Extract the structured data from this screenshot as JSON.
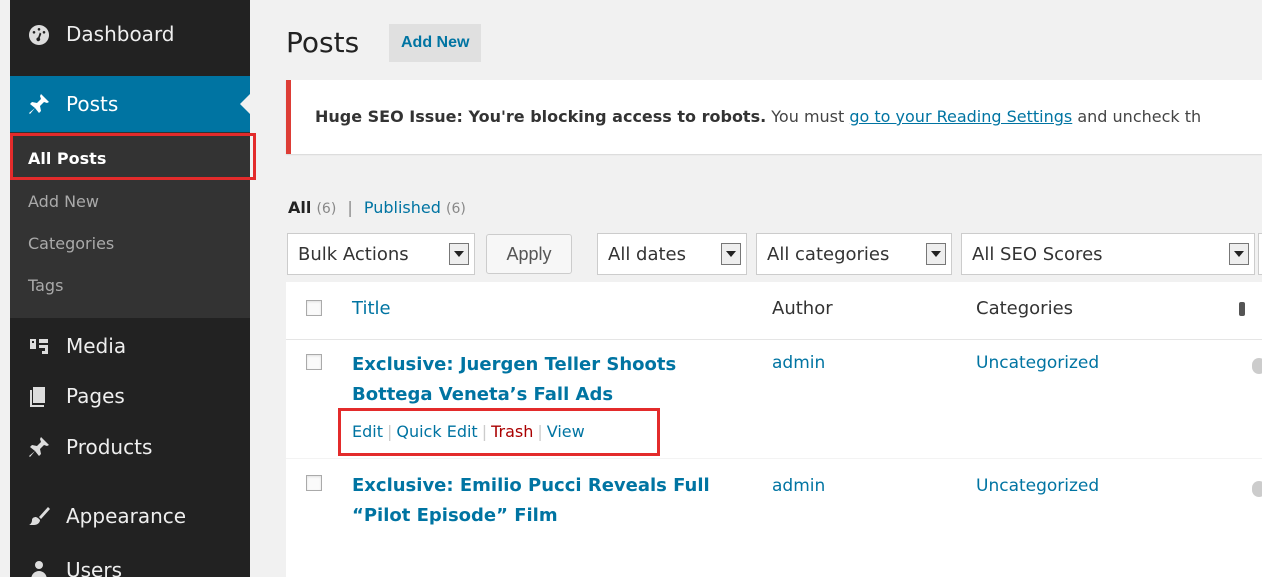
{
  "sidebar": {
    "items": [
      {
        "label": "Dashboard",
        "icon": "dashboard-icon"
      },
      {
        "label": "Posts",
        "icon": "pin-icon"
      },
      {
        "label": "Media",
        "icon": "media-icon"
      },
      {
        "label": "Pages",
        "icon": "pages-icon"
      },
      {
        "label": "Products",
        "icon": "pin-icon"
      },
      {
        "label": "Appearance",
        "icon": "paintbrush-icon"
      },
      {
        "label": "Users",
        "icon": "user-icon"
      }
    ],
    "submenu": [
      "All Posts",
      "Add New",
      "Categories",
      "Tags"
    ]
  },
  "header": {
    "title": "Posts",
    "add_new": "Add New"
  },
  "notice": {
    "bold": "Huge SEO Issue: You're blocking access to robots.",
    "text": " You must ",
    "link": "go to your Reading Settings",
    "rest": " and uncheck th"
  },
  "filters": {
    "all_label": "All",
    "all_count": "(6)",
    "sep": "|",
    "published_label": "Published",
    "published_count": "(6)"
  },
  "toolbar": {
    "bulk_actions": "Bulk Actions",
    "apply": "Apply",
    "dates": "All dates",
    "categories": "All categories",
    "seo": "All SEO Scores"
  },
  "table": {
    "columns": [
      "Title",
      "Author",
      "Categories"
    ],
    "rows": [
      {
        "title_line1": "Exclusive: Juergen Teller Shoots",
        "title_line2": "Bottega Veneta’s Fall Ads",
        "author": "admin",
        "category": "Uncategorized"
      },
      {
        "title_line1": "Exclusive: Emilio Pucci Reveals Full",
        "title_line2": "“Pilot Episode” Film",
        "author": "admin",
        "category": "Uncategorized"
      }
    ],
    "row_actions": [
      "Edit",
      "Quick Edit",
      "Trash",
      "View"
    ]
  },
  "colors": {
    "accent": "#0074a2",
    "sidebar": "#222222",
    "highlight": "#e32b2b",
    "trash": "#aa0000"
  }
}
